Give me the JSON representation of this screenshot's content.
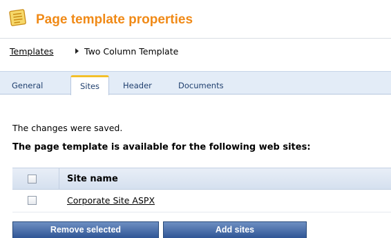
{
  "header": {
    "icon": "page-template-icon",
    "title": "Page template properties",
    "accent_color": "#f08a17"
  },
  "breadcrumb": {
    "parent": "Templates",
    "current": "Two Column Template"
  },
  "tabs": [
    {
      "label": "General"
    },
    {
      "label": "Sites",
      "active": true
    },
    {
      "label": "Header"
    },
    {
      "label": "Documents"
    }
  ],
  "main": {
    "status_message": "The changes were saved.",
    "section_title": "The page template is available for the following web sites:"
  },
  "grid": {
    "column_header": "Site name",
    "rows": [
      {
        "site_name": "Corporate Site ASPX",
        "checked": false
      }
    ]
  },
  "actions": {
    "remove_label": "Remove selected",
    "add_label": "Add sites"
  }
}
